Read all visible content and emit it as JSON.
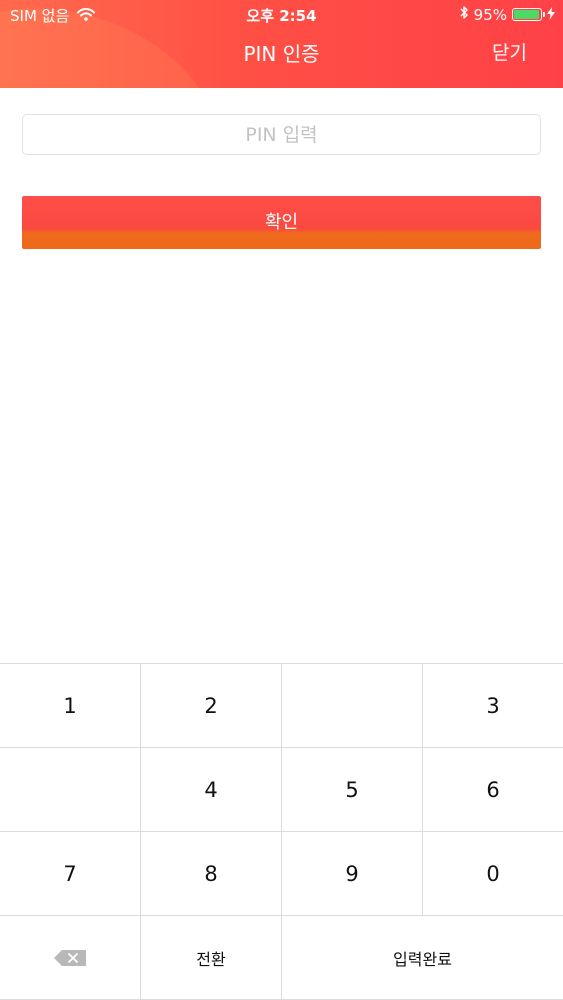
{
  "status_bar": {
    "carrier": "SIM 없음",
    "time": "오후 2:54",
    "battery_percent": "95%",
    "battery_level": 0.95,
    "battery_color": "#4cd964",
    "icons": [
      "wifi-icon",
      "bluetooth-icon",
      "battery-icon",
      "charging-icon"
    ]
  },
  "header": {
    "title": "PIN 인증",
    "close_label": "닫기",
    "accent_color": "#ff4a45"
  },
  "form": {
    "pin_value": "",
    "pin_placeholder": "PIN 입력",
    "confirm_label": "확인"
  },
  "keypad": {
    "row1": {
      "k1": "1",
      "k2": "2",
      "k3": "",
      "k4": "3"
    },
    "row2": {
      "k1": "",
      "k2": "4",
      "k3": "5",
      "k4": "6"
    },
    "row3": {
      "k1": "7",
      "k2": "8",
      "k3": "9",
      "k4": "0"
    },
    "row4": {
      "backspace_icon": "backspace-icon",
      "switch_label": "전환",
      "done_label": "입력완료"
    }
  }
}
